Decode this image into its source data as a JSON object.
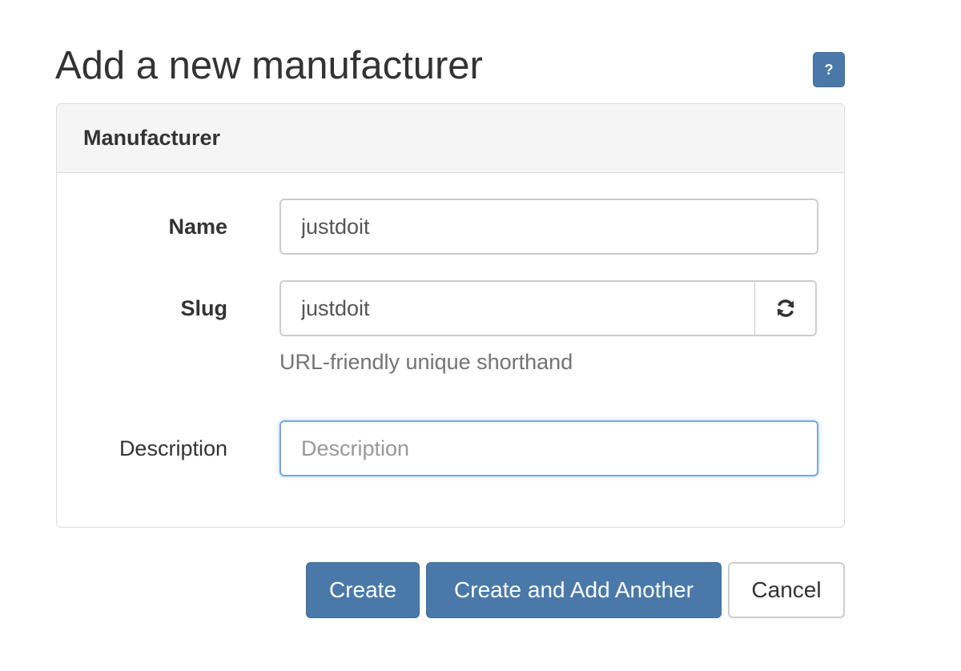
{
  "page": {
    "title": "Add a new manufacturer",
    "help_label": "?"
  },
  "panel": {
    "heading": "Manufacturer"
  },
  "form": {
    "name": {
      "label": "Name",
      "value": "justdoit"
    },
    "slug": {
      "label": "Slug",
      "value": "justdoit",
      "help_text": "URL-friendly unique shorthand",
      "regenerate_icon": "refresh-icon"
    },
    "description": {
      "label": "Description",
      "value": "",
      "placeholder": "Description"
    }
  },
  "actions": {
    "create_label": "Create",
    "create_another_label": "Create and Add Another",
    "cancel_label": "Cancel"
  },
  "colors": {
    "primary": "#4a79a9",
    "focus_border": "#7aa6da",
    "panel_heading_bg": "#f5f5f5"
  }
}
